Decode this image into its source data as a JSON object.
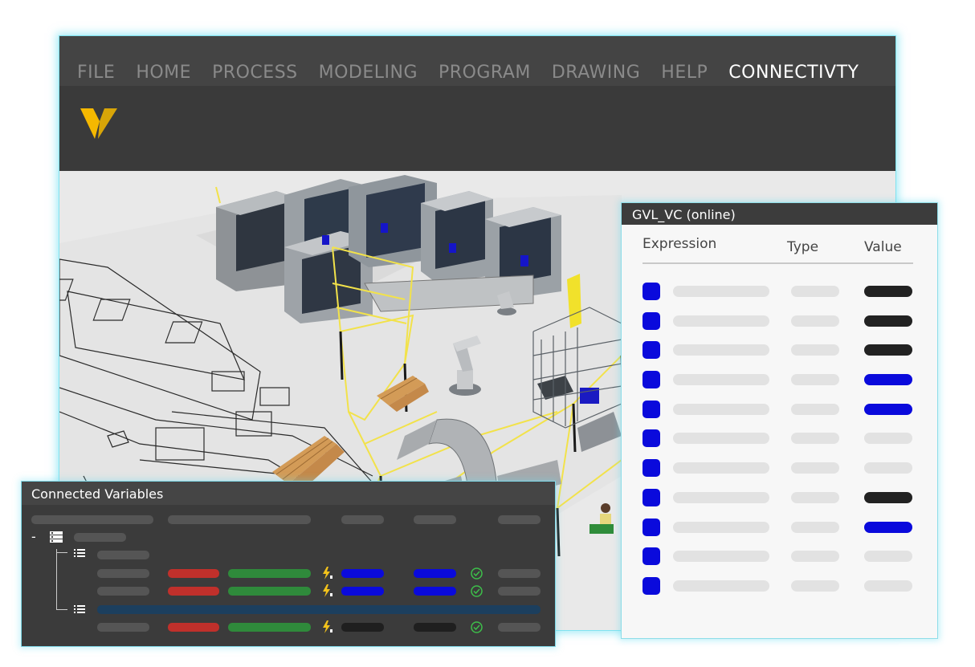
{
  "menu": {
    "items": [
      "FILE",
      "HOME",
      "PROCESS",
      "MODELING",
      "PROGRAM",
      "DRAWING",
      "HELP",
      "CONNECTIVTY"
    ],
    "active": "CONNECTIVTY"
  },
  "logo": {
    "icon": "v-logo-icon",
    "color": "#f5b800"
  },
  "gvl_panel": {
    "title": "GVL_VC (online)",
    "columns": {
      "expression": "Expression",
      "type": "Type",
      "value": "Value"
    },
    "rows": [
      {
        "value_color": "#222222"
      },
      {
        "value_color": "#222222"
      },
      {
        "value_color": "#222222"
      },
      {
        "value_color": "#0a0adc"
      },
      {
        "value_color": "#0a0adc"
      },
      {
        "value_color": "#e2e2e2"
      },
      {
        "value_color": "#e2e2e2"
      },
      {
        "value_color": "#222222"
      },
      {
        "value_color": "#0a0adc"
      },
      {
        "value_color": "#e2e2e2"
      },
      {
        "value_color": "#e2e2e2"
      }
    ]
  },
  "connected_panel": {
    "title": "Connected Variables",
    "collapse_symbol": "-",
    "colors": {
      "red": "#c0302b",
      "green": "#2f8a3b",
      "blue": "#0a0adc",
      "dark": "#1f1f1f",
      "highlight": "#1c3f5e",
      "check": "#3dbf4a",
      "bolt": "#f2c21b"
    }
  }
}
